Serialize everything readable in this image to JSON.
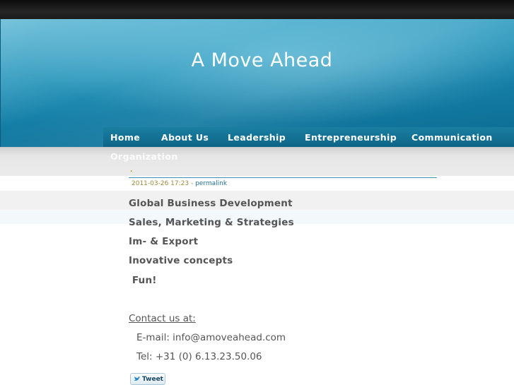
{
  "site": {
    "title": "A Move Ahead"
  },
  "nav": {
    "items": [
      {
        "label": "Home"
      },
      {
        "label": "About Us"
      },
      {
        "label": "Leadership"
      },
      {
        "label": "Entrepreneurship"
      },
      {
        "label": "Communication"
      },
      {
        "label": "Organization"
      }
    ]
  },
  "post": {
    "title_marker": ".",
    "timestamp": "2011-03-26 17:23",
    "meta_separator": " - ",
    "permalink_label": "permalink",
    "services": [
      "Global Business Development",
      "Sales, Marketing & Strategies",
      "Im- & Export",
      "Inovative concepts",
      " Fun!"
    ],
    "contact": {
      "heading": "Contact us at:",
      "email_line": "E-mail: info@amoveahead.com",
      "tel_line": "Tel: +31 (0) 6.13.23.50.06"
    },
    "tweet_label": "Tweet"
  },
  "colors": {
    "banner_accent": "#1a8cb4",
    "nav_bg": "#0d6587",
    "text_gray": "#555555",
    "meta_link": "#1f6f98"
  },
  "icons": {
    "tweet_button": "twitter-bird-icon"
  }
}
